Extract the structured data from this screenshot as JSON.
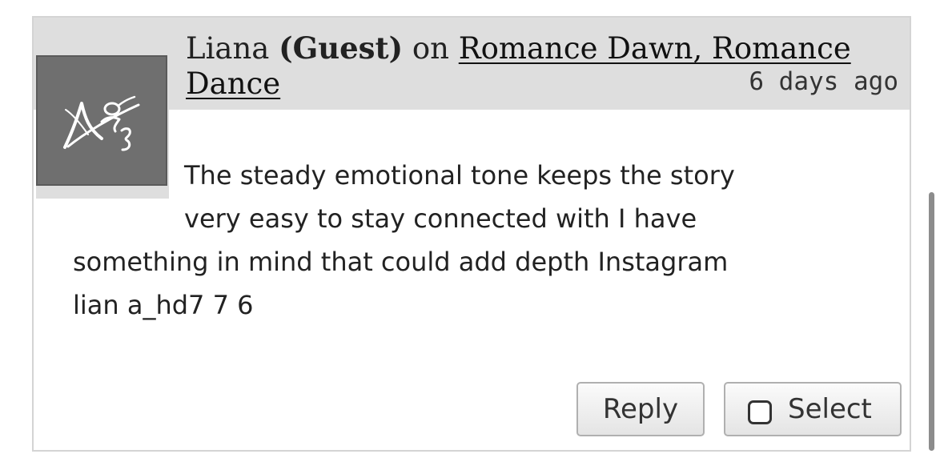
{
  "comment": {
    "author": "Liana",
    "guest_label": "(Guest)",
    "on_text": "on",
    "story_title": "Romance Dawn, Romance Dance",
    "timestamp": "6 days ago",
    "body_lines": [
      "The steady emotional tone keeps the story",
      "very easy to stay connected with I have",
      "something in mind that could add depth Instagram",
      "lian a_hd7 7 6"
    ]
  },
  "actions": {
    "reply_label": "Reply",
    "select_label": "Select"
  },
  "avatar": {
    "icon": "ao3-logo-icon",
    "background_color": "#6f6f6f"
  }
}
